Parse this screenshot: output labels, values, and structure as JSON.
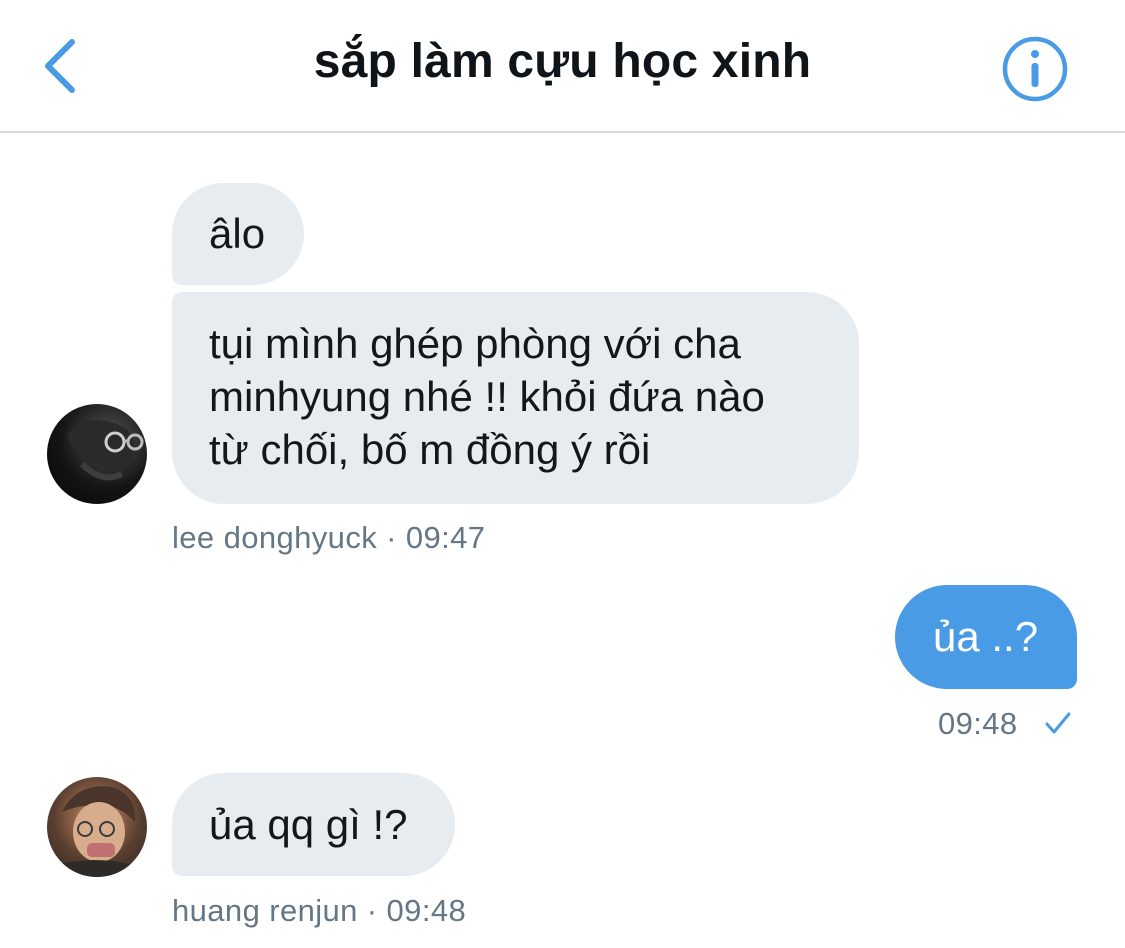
{
  "header": {
    "title": "sắp làm cựu học xinh",
    "back_icon": "chevron-left-icon",
    "info_icon": "info-icon",
    "accent_color": "#4a9be6"
  },
  "messages": [
    {
      "direction": "incoming",
      "text": "âlo"
    },
    {
      "direction": "incoming",
      "text": "tụi mình ghép phòng với cha\nminhyung nhé !! khỏi đứa nào\ntừ chối, bố m đồng ý rồi",
      "meta": "lee donghyuck · 09:47"
    },
    {
      "direction": "outgoing",
      "text": "ủa ..?",
      "meta": "09:48",
      "status_icon": "check-icon"
    },
    {
      "direction": "incoming",
      "text": "ủa qq gì !?",
      "meta": "huang renjun · 09:48"
    }
  ],
  "colors": {
    "incoming_bubble": "#e6ecf0",
    "outgoing_bubble": "#4a9be6",
    "meta_text": "#657786"
  }
}
